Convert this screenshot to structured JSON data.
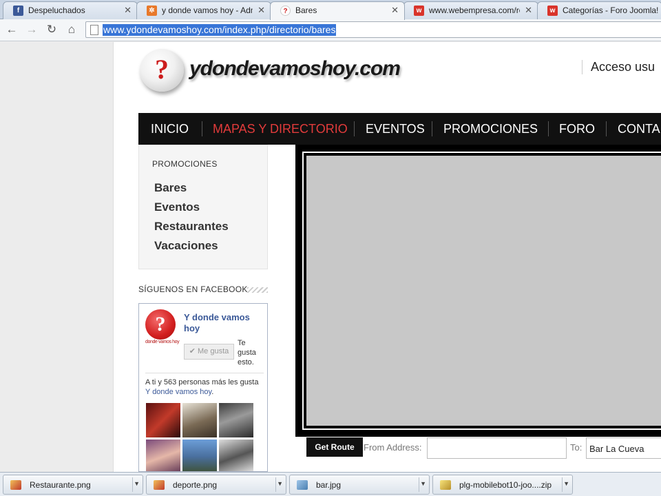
{
  "browser": {
    "tabs": [
      {
        "title": "Despeluchados",
        "favicon": "facebook-icon",
        "favicon_glyph": "f",
        "color": "#3b5998"
      },
      {
        "title": "y donde vamos hoy - Adm",
        "favicon": "joomla-icon",
        "favicon_glyph": "✲",
        "color": "#e8792b"
      },
      {
        "title": "Bares",
        "favicon": "question-icon",
        "favicon_glyph": "?",
        "color": "#cc1c1c"
      },
      {
        "title": "www.webempresa.com/re",
        "favicon": "webempresa-icon",
        "favicon_glyph": "w",
        "color": "#d9342b"
      },
      {
        "title": "Categorías - Foro Joomla!",
        "favicon": "webempresa-icon",
        "favicon_glyph": "w",
        "color": "#d9342b"
      }
    ],
    "tab_close_glyph": "✕",
    "url": "www.ydondevamoshoy.com/index.php/directorio/bares",
    "nav": {
      "back_glyph": "←",
      "forward_glyph": "→",
      "reload_glyph": "↻",
      "home_glyph": "⌂"
    }
  },
  "site": {
    "logo_mark": "?",
    "logo_text": "ydondevamoshoy.com",
    "login_link": "Acceso usu",
    "nav": [
      {
        "label": "INICIO",
        "active": false
      },
      {
        "label": "MAPAS Y DIRECTORIO",
        "active": true
      },
      {
        "label": "EVENTOS",
        "active": false
      },
      {
        "label": "PROMOCIONES",
        "active": false
      },
      {
        "label": "FORO",
        "active": false
      },
      {
        "label": "CONTA",
        "active": false
      }
    ],
    "side_menu": {
      "heading": "PROMOCIONES",
      "links": [
        "Bares",
        "Eventos",
        "Restaurantes",
        "Vacaciones"
      ]
    },
    "facebook": {
      "heading": "SÍGUENOS EN FACEBOOK",
      "page_name": "Y donde vamos hoy",
      "logo_glyph": "?",
      "logo_caption": "donde vamos hoy",
      "like_button": "✔ Me gusta",
      "like_side": "Te gusta esto.",
      "social_text": "A ti y 563 personas más les gusta ",
      "social_link": "Y donde vamos hoy",
      "social_end": "."
    },
    "route": {
      "button": "Get Route",
      "from_label": "From Address:",
      "from_value": "",
      "to_label": "To:",
      "to_value": "Bar La Cueva"
    }
  },
  "downloads": [
    {
      "name": "Restaurante.png",
      "icon": "image-file-icon"
    },
    {
      "name": "deporte.png",
      "icon": "image-file-icon"
    },
    {
      "name": "bar.jpg",
      "icon": "image-file-icon"
    },
    {
      "name": "plg-mobilebot10-joo....zip",
      "icon": "zip-file-icon"
    }
  ]
}
